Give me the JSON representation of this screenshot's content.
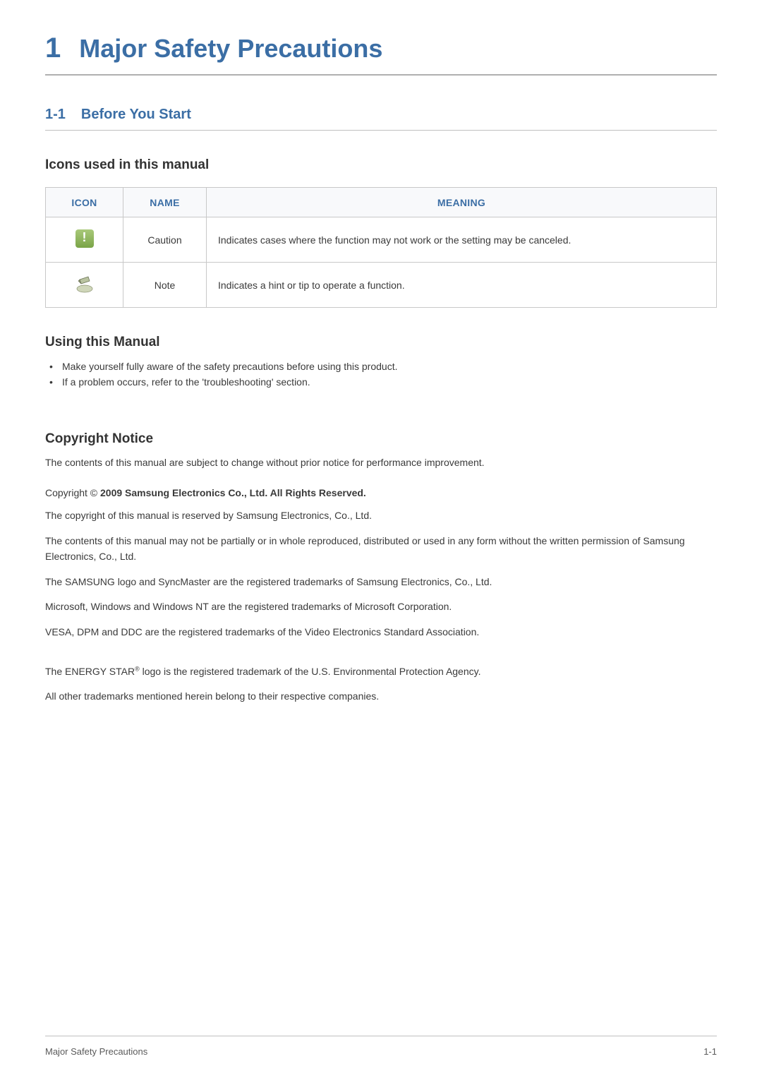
{
  "chapter": {
    "number": "1",
    "title": "Major Safety Precautions"
  },
  "section": {
    "number": "1-1",
    "title": "Before You Start"
  },
  "icons_heading": "Icons used in this manual",
  "icon_table": {
    "headers": {
      "icon": "ICON",
      "name": "NAME",
      "meaning": "MEANING"
    },
    "rows": [
      {
        "name": "Caution",
        "meaning": "Indicates cases where the function may not work or the setting may be canceled."
      },
      {
        "name": "Note",
        "meaning": "Indicates a hint or tip to operate a function."
      }
    ]
  },
  "using_manual": {
    "heading": "Using this Manual",
    "items": [
      "Make yourself fully aware of the safety precautions before using this product.",
      "If a problem occurs, refer to the 'troubleshooting' section."
    ]
  },
  "copyright": {
    "heading": "Copyright Notice",
    "intro": "The contents of this manual are subject to change without prior notice for performance improvement.",
    "line_prefix": "Copyright © ",
    "line_bold": " 2009 Samsung Electronics Co., Ltd. All Rights Reserved.",
    "paras": [
      "The copyright of this manual is reserved by Samsung Electronics, Co., Ltd.",
      "The contents of this manual may not be partially or in whole reproduced, distributed or used in any form without the written permission of Samsung Electronics, Co., Ltd.",
      "The SAMSUNG logo and SyncMaster are the registered trademarks of Samsung Electronics, Co., Ltd.",
      "Microsoft, Windows and Windows NT are the registered trademarks of Microsoft Corporation.",
      "VESA, DPM and DDC are the registered trademarks of the Video Electronics Standard Association."
    ],
    "energy_star_pre": "The ENERGY STAR",
    "energy_star_sup": "®",
    "energy_star_post": " logo is the registered trademark of the U.S. Environmental Protection Agency.",
    "final": "All other trademarks mentioned herein belong to their respective companies."
  },
  "footer": {
    "left": "Major Safety Precautions",
    "right": "1-1"
  }
}
